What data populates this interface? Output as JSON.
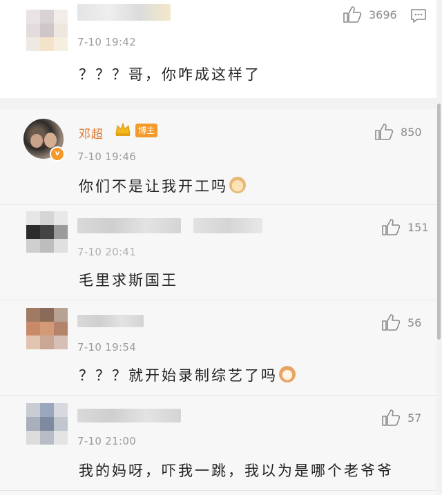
{
  "comments": [
    {
      "time": "7-10 19:42",
      "text": "？？？哥，你咋成这样了",
      "likes": "3696"
    },
    {
      "name": "邓超",
      "badge": "博主",
      "time": "7-10 19:46",
      "text": "你们不是让我开工吗",
      "likes": "850"
    },
    {
      "time": "7-10 20:41",
      "text": "毛里求斯国王",
      "likes": "151"
    },
    {
      "time": "7-10 19:54",
      "text": "？？？就开始录制综艺了吗",
      "likes": "56"
    },
    {
      "time": "7-10 21:00",
      "text": "我的妈呀，吓我一跳，我以为是哪个老爷爷",
      "likes": "57"
    }
  ],
  "colors": {
    "blogger_name": "#e0762a",
    "badge_bg": "#f39a2b",
    "crown": "#f2b81c"
  },
  "icons": [
    "thumbs-up-icon",
    "reply-icon",
    "crown-icon",
    "verified-icon",
    "doge-emoji",
    "cat-emoji"
  ]
}
